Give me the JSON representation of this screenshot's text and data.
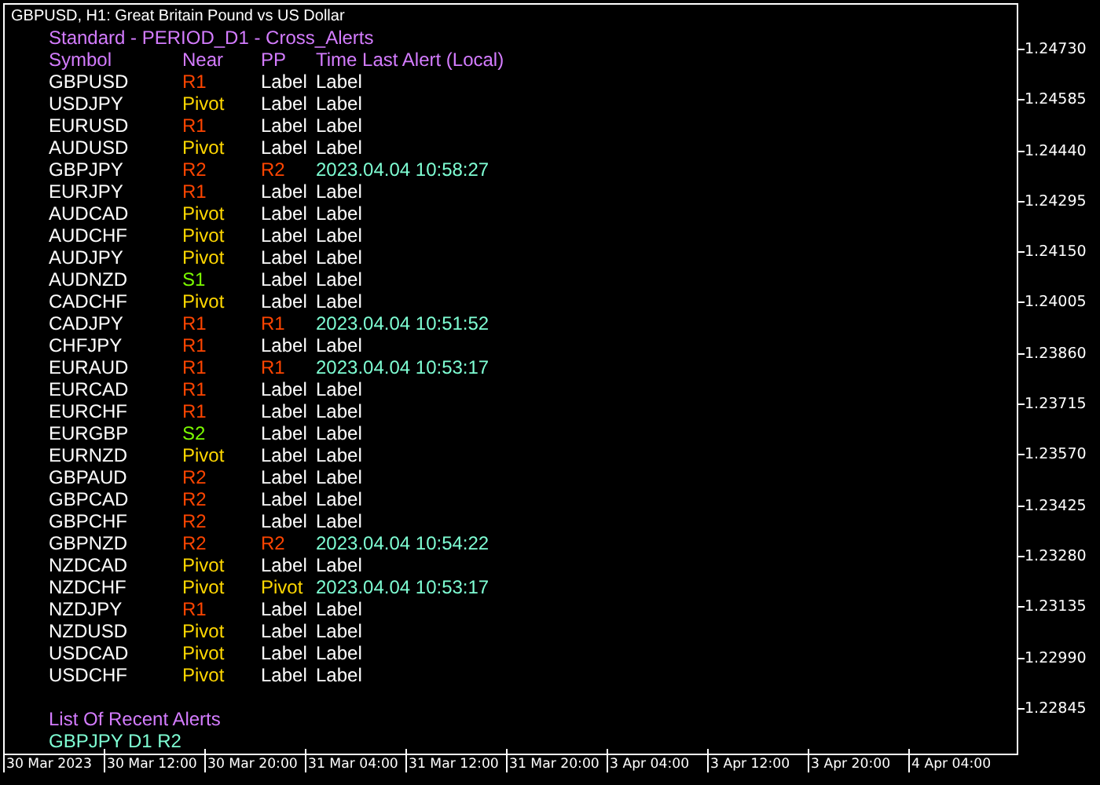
{
  "chart_title": "GBPUSD, H1:  Great Britain Pound vs US Dollar",
  "panel": {
    "title": "Standard - PERIOD_D1 - Cross_Alerts",
    "columns": [
      "Symbol",
      "Near",
      "PP",
      "Time Last Alert (Local)"
    ],
    "rows": [
      {
        "symbol": "GBPUSD",
        "near": {
          "text": "R1",
          "color": "#ff4500"
        },
        "pp": {
          "text": "Label",
          "color": "#ffffff"
        },
        "time": {
          "text": "Label",
          "color": "#ffffff"
        }
      },
      {
        "symbol": "USDJPY",
        "near": {
          "text": "Pivot",
          "color": "#ffd700"
        },
        "pp": {
          "text": "Label",
          "color": "#ffffff"
        },
        "time": {
          "text": "Label",
          "color": "#ffffff"
        }
      },
      {
        "symbol": "EURUSD",
        "near": {
          "text": "R1",
          "color": "#ff4500"
        },
        "pp": {
          "text": "Label",
          "color": "#ffffff"
        },
        "time": {
          "text": "Label",
          "color": "#ffffff"
        }
      },
      {
        "symbol": "AUDUSD",
        "near": {
          "text": "Pivot",
          "color": "#ffd700"
        },
        "pp": {
          "text": "Label",
          "color": "#ffffff"
        },
        "time": {
          "text": "Label",
          "color": "#ffffff"
        }
      },
      {
        "symbol": "GBPJPY",
        "near": {
          "text": "R2",
          "color": "#ff4500"
        },
        "pp": {
          "text": "R2",
          "color": "#ff4500"
        },
        "time": {
          "text": "2023.04.04 10:58:27",
          "color": "#7fffd4"
        }
      },
      {
        "symbol": "EURJPY",
        "near": {
          "text": "R1",
          "color": "#ff4500"
        },
        "pp": {
          "text": "Label",
          "color": "#ffffff"
        },
        "time": {
          "text": "Label",
          "color": "#ffffff"
        }
      },
      {
        "symbol": "AUDCAD",
        "near": {
          "text": "Pivot",
          "color": "#ffd700"
        },
        "pp": {
          "text": "Label",
          "color": "#ffffff"
        },
        "time": {
          "text": "Label",
          "color": "#ffffff"
        }
      },
      {
        "symbol": "AUDCHF",
        "near": {
          "text": "Pivot",
          "color": "#ffd700"
        },
        "pp": {
          "text": "Label",
          "color": "#ffffff"
        },
        "time": {
          "text": "Label",
          "color": "#ffffff"
        }
      },
      {
        "symbol": "AUDJPY",
        "near": {
          "text": "Pivot",
          "color": "#ffd700"
        },
        "pp": {
          "text": "Label",
          "color": "#ffffff"
        },
        "time": {
          "text": "Label",
          "color": "#ffffff"
        }
      },
      {
        "symbol": "AUDNZD",
        "near": {
          "text": "S1",
          "color": "#7cfc00"
        },
        "pp": {
          "text": "Label",
          "color": "#ffffff"
        },
        "time": {
          "text": "Label",
          "color": "#ffffff"
        }
      },
      {
        "symbol": "CADCHF",
        "near": {
          "text": "Pivot",
          "color": "#ffd700"
        },
        "pp": {
          "text": "Label",
          "color": "#ffffff"
        },
        "time": {
          "text": "Label",
          "color": "#ffffff"
        }
      },
      {
        "symbol": "CADJPY",
        "near": {
          "text": "R1",
          "color": "#ff4500"
        },
        "pp": {
          "text": "R1",
          "color": "#ff4500"
        },
        "time": {
          "text": "2023.04.04 10:51:52",
          "color": "#7fffd4"
        }
      },
      {
        "symbol": "CHFJPY",
        "near": {
          "text": "R1",
          "color": "#ff4500"
        },
        "pp": {
          "text": "Label",
          "color": "#ffffff"
        },
        "time": {
          "text": "Label",
          "color": "#ffffff"
        }
      },
      {
        "symbol": "EURAUD",
        "near": {
          "text": "R1",
          "color": "#ff4500"
        },
        "pp": {
          "text": "R1",
          "color": "#ff4500"
        },
        "time": {
          "text": "2023.04.04 10:53:17",
          "color": "#7fffd4"
        }
      },
      {
        "symbol": "EURCAD",
        "near": {
          "text": "R1",
          "color": "#ff4500"
        },
        "pp": {
          "text": "Label",
          "color": "#ffffff"
        },
        "time": {
          "text": "Label",
          "color": "#ffffff"
        }
      },
      {
        "symbol": "EURCHF",
        "near": {
          "text": "R1",
          "color": "#ff4500"
        },
        "pp": {
          "text": "Label",
          "color": "#ffffff"
        },
        "time": {
          "text": "Label",
          "color": "#ffffff"
        }
      },
      {
        "symbol": "EURGBP",
        "near": {
          "text": "S2",
          "color": "#7cfc00"
        },
        "pp": {
          "text": "Label",
          "color": "#ffffff"
        },
        "time": {
          "text": "Label",
          "color": "#ffffff"
        }
      },
      {
        "symbol": "EURNZD",
        "near": {
          "text": "Pivot",
          "color": "#ffd700"
        },
        "pp": {
          "text": "Label",
          "color": "#ffffff"
        },
        "time": {
          "text": "Label",
          "color": "#ffffff"
        }
      },
      {
        "symbol": "GBPAUD",
        "near": {
          "text": "R2",
          "color": "#ff4500"
        },
        "pp": {
          "text": "Label",
          "color": "#ffffff"
        },
        "time": {
          "text": "Label",
          "color": "#ffffff"
        }
      },
      {
        "symbol": "GBPCAD",
        "near": {
          "text": "R2",
          "color": "#ff4500"
        },
        "pp": {
          "text": "Label",
          "color": "#ffffff"
        },
        "time": {
          "text": "Label",
          "color": "#ffffff"
        }
      },
      {
        "symbol": "GBPCHF",
        "near": {
          "text": "R2",
          "color": "#ff4500"
        },
        "pp": {
          "text": "Label",
          "color": "#ffffff"
        },
        "time": {
          "text": "Label",
          "color": "#ffffff"
        }
      },
      {
        "symbol": "GBPNZD",
        "near": {
          "text": "R2",
          "color": "#ff4500"
        },
        "pp": {
          "text": "R2",
          "color": "#ff4500"
        },
        "time": {
          "text": "2023.04.04 10:54:22",
          "color": "#7fffd4"
        }
      },
      {
        "symbol": "NZDCAD",
        "near": {
          "text": "Pivot",
          "color": "#ffd700"
        },
        "pp": {
          "text": "Label",
          "color": "#ffffff"
        },
        "time": {
          "text": "Label",
          "color": "#ffffff"
        }
      },
      {
        "symbol": "NZDCHF",
        "near": {
          "text": "Pivot",
          "color": "#ffd700"
        },
        "pp": {
          "text": "Pivot",
          "color": "#ffd700"
        },
        "time": {
          "text": "2023.04.04 10:53:17",
          "color": "#7fffd4"
        }
      },
      {
        "symbol": "NZDJPY",
        "near": {
          "text": "R1",
          "color": "#ff4500"
        },
        "pp": {
          "text": "Label",
          "color": "#ffffff"
        },
        "time": {
          "text": "Label",
          "color": "#ffffff"
        }
      },
      {
        "symbol": "NZDUSD",
        "near": {
          "text": "Pivot",
          "color": "#ffd700"
        },
        "pp": {
          "text": "Label",
          "color": "#ffffff"
        },
        "time": {
          "text": "Label",
          "color": "#ffffff"
        }
      },
      {
        "symbol": "USDCAD",
        "near": {
          "text": "Pivot",
          "color": "#ffd700"
        },
        "pp": {
          "text": "Label",
          "color": "#ffffff"
        },
        "time": {
          "text": "Label",
          "color": "#ffffff"
        }
      },
      {
        "symbol": "USDCHF",
        "near": {
          "text": "Pivot",
          "color": "#ffd700"
        },
        "pp": {
          "text": "Label",
          "color": "#ffffff"
        },
        "time": {
          "text": "Label",
          "color": "#ffffff"
        }
      }
    ],
    "recent_title": "List Of Recent Alerts",
    "recent_alerts": [
      "GBPJPY D1 R2"
    ]
  },
  "price_axis": [
    "1.24730",
    "1.24585",
    "1.24440",
    "1.24295",
    "1.24150",
    "1.24005",
    "1.23860",
    "1.23715",
    "1.23570",
    "1.23425",
    "1.23280",
    "1.23135",
    "1.22990",
    "1.22845"
  ],
  "time_axis": [
    "30 Mar 2023",
    "30 Mar 12:00",
    "30 Mar 20:00",
    "31 Mar 04:00",
    "31 Mar 12:00",
    "31 Mar 20:00",
    "3 Apr 04:00",
    "3 Apr 12:00",
    "3 Apr 20:00",
    "4 Apr 04:00"
  ]
}
